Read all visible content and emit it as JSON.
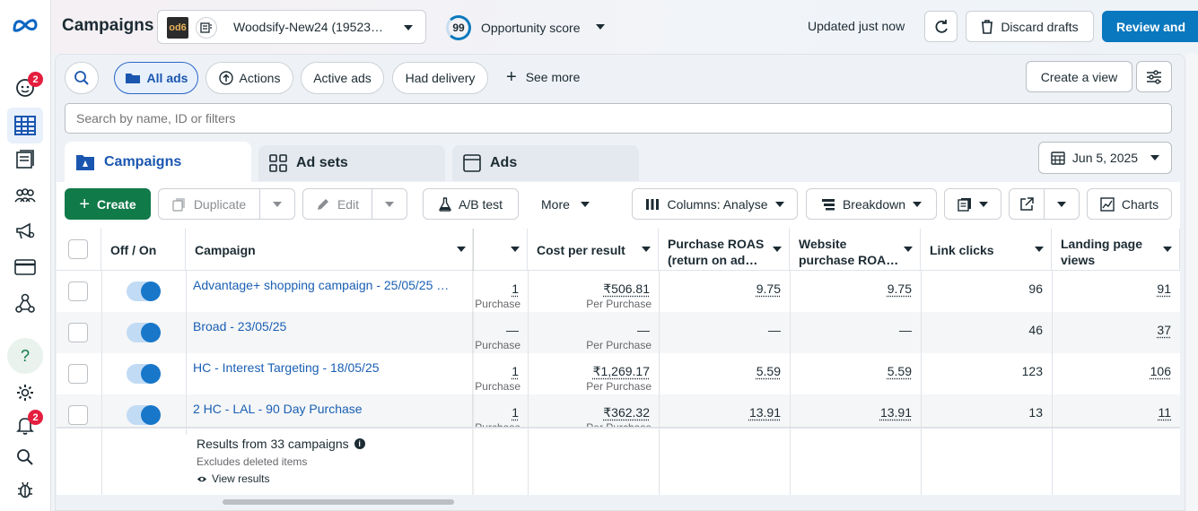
{
  "header": {
    "title": "Campaigns",
    "account": "Woodsify-New24 (19523…",
    "account_logo_text": "od6",
    "opportunity_score": "99",
    "opportunity_label": "Opportunity score",
    "updated": "Updated just now",
    "discard": "Discard drafts",
    "review": "Review and"
  },
  "rail": {
    "badge_top": "2",
    "badge_bottom": "2"
  },
  "filters": {
    "chips": [
      "All ads",
      "Actions",
      "Active ads",
      "Had delivery"
    ],
    "see_more": "See more",
    "create_view": "Create a view",
    "search_placeholder": "Search by name, ID or filters"
  },
  "tabs": {
    "campaigns": "Campaigns",
    "adsets": "Ad sets",
    "ads": "Ads",
    "date": "Jun 5, 2025"
  },
  "toolbar": {
    "create": "Create",
    "duplicate": "Duplicate",
    "edit": "Edit",
    "ab_test": "A/B test",
    "more": "More",
    "columns": "Columns: Analyse",
    "breakdown": "Breakdown",
    "charts": "Charts"
  },
  "table": {
    "headers": {
      "onoff": "Off / On",
      "campaign": "Campaign",
      "cost": "Cost per result",
      "roas1": "Purchase ROAS",
      "roas2": "(return on ad…",
      "wroas1": "Website",
      "wroas2": "purchase ROA…",
      "clicks": "Link clicks",
      "lpv1": "Landing page",
      "lpv2": "views"
    },
    "rows": [
      {
        "name": "Advantage+ shopping campaign - 25/05/25 …",
        "results": "1",
        "results_sub": "Purchase",
        "cost": "₹506.81",
        "cost_sub": "Per Purchase",
        "roas": "9.75",
        "wroas": "9.75",
        "clicks": "96",
        "lpv": "91"
      },
      {
        "name": "Broad - 23/05/25",
        "results": "—",
        "results_sub": "Purchase",
        "cost": "—",
        "cost_sub": "Per Purchase",
        "roas": "—",
        "wroas": "—",
        "clicks": "46",
        "lpv": "37"
      },
      {
        "name": "HC - Interest Targeting - 18/05/25",
        "results": "1",
        "results_sub": "Purchase",
        "cost": "₹1,269.17",
        "cost_sub": "Per Purchase",
        "roas": "5.59",
        "wroas": "5.59",
        "clicks": "123",
        "lpv": "106"
      },
      {
        "name": "2 HC - LAL - 90 Day Purchase",
        "results": "1",
        "results_sub": "Purchase",
        "cost": "₹362.32",
        "cost_sub": "Per Purchase",
        "roas": "13.91",
        "wroas": "13.91",
        "clicks": "13",
        "lpv": "11"
      }
    ],
    "footer": {
      "title": "Results from 33 campaigns",
      "sub": "Excludes deleted items",
      "link": "View results"
    }
  }
}
